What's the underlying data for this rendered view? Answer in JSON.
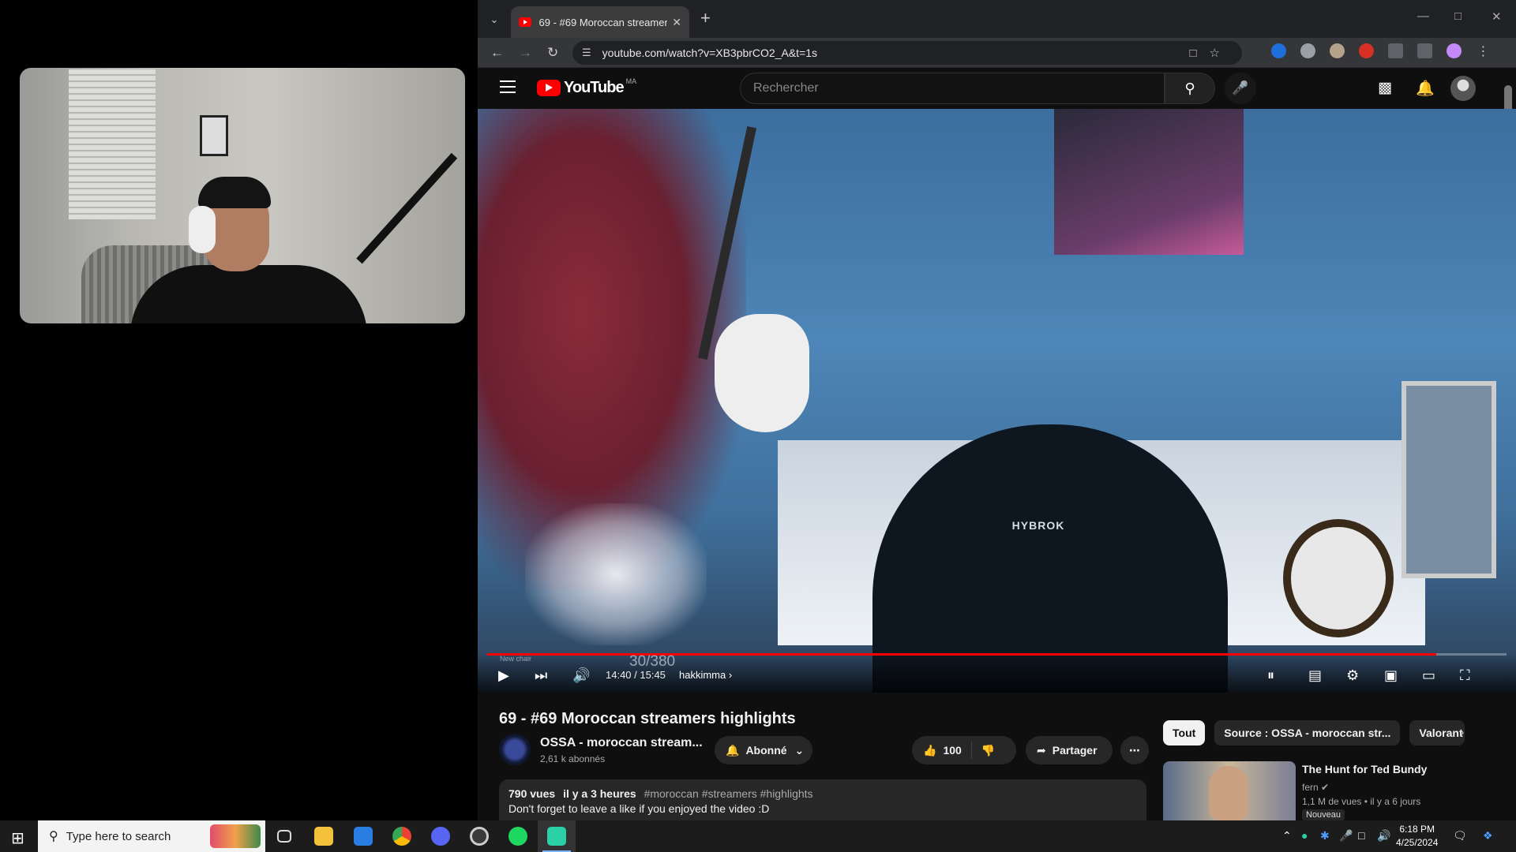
{
  "browser": {
    "tab_title": "69 - #69 Moroccan streamers highlights",
    "new_tab_symbol": "+",
    "url": "youtube.com/watch?v=XB3pbrCO2_A&t=1s"
  },
  "youtube": {
    "logo_text": "YouTube",
    "country_code": "MA",
    "search_placeholder": "Rechercher"
  },
  "player": {
    "overlay_counter": "30/380",
    "overlay_small": "New chair",
    "current_time": "14:40",
    "duration": "15:45",
    "time_display": "14:40 / 15:45",
    "chapter": "hakkimma",
    "progress_fraction": 0.931,
    "chair_logo": "HYBROK"
  },
  "video": {
    "title": "69 - #69 Moroccan streamers highlights",
    "channel_name": "OSSA - moroccan stream...",
    "subscribers": "2,61 k abonnés",
    "subscribe_label": "Abonné",
    "like_count": "100",
    "share_label": "Partager",
    "views": "790 vues",
    "uploaded": "il y a 3 heures",
    "tags": "#moroccan #streamers #highlights",
    "description": "Don't forget to leave a like if you enjoyed the video :D"
  },
  "sidebar": {
    "chips": [
      "Tout",
      "Source : OSSA - moroccan str...",
      "Valorant"
    ],
    "recommendation": {
      "title": "The Hunt for Ted Bundy",
      "channel": "fern",
      "views": "1,1 M de vues",
      "age": "il y a 6 jours",
      "badge": "Nouveau"
    }
  },
  "taskbar": {
    "search_placeholder": "Type here to search",
    "time": "6:18 PM",
    "date": "4/25/2024"
  },
  "colors": {
    "youtube_red": "#ff0000",
    "player_bg": "#4d86b8",
    "taskbar_bg": "#1c1c1c"
  }
}
